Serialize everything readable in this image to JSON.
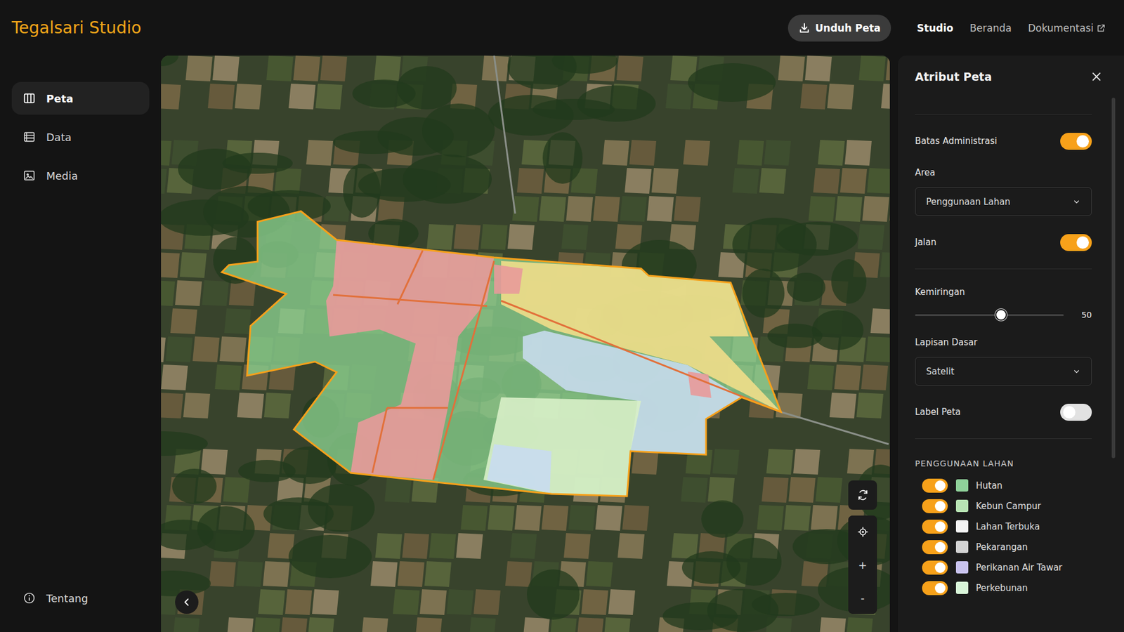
{
  "app": {
    "title": "Tegalsari Studio"
  },
  "header": {
    "download_button": {
      "label": "Unduh Peta"
    },
    "nav": [
      {
        "label": "Studio",
        "selected": true,
        "external": false
      },
      {
        "label": "Beranda",
        "selected": false,
        "external": false
      },
      {
        "label": "Dokumentasi",
        "selected": false,
        "external": true
      }
    ]
  },
  "sidebar": {
    "items": [
      {
        "label": "Peta",
        "selected": true
      },
      {
        "label": "Data",
        "selected": false
      },
      {
        "label": "Media",
        "selected": false
      }
    ],
    "footer": {
      "label": "Tentang"
    }
  },
  "map": {
    "zoom_in": "+",
    "zoom_out": "-"
  },
  "panel": {
    "title": "Atribut Peta",
    "sections": [
      [
        {
          "kind": "toggle",
          "label": "Batas Administrasi",
          "on": true
        },
        {
          "kind": "select",
          "label": "Area",
          "value": "Penggunaan Lahan"
        },
        {
          "kind": "toggle",
          "label": "Jalan",
          "on": true
        }
      ],
      [
        {
          "kind": "slider",
          "label": "Kemiringan",
          "level": 0.58,
          "reading": "50"
        },
        {
          "kind": "select",
          "label": "Lapisan Dasar",
          "value": "Satelit"
        },
        {
          "kind": "toggle",
          "label": "Label Peta",
          "on": false
        }
      ]
    ],
    "land_use": {
      "heading": "PENGGUNAAN LAHAN",
      "items": [
        {
          "label": "Hutan",
          "on": true,
          "color": "#8fd19a"
        },
        {
          "label": "Kebun Campur",
          "on": true,
          "color": "#b8e4b4"
        },
        {
          "label": "Lahan Terbuka",
          "on": true,
          "color": "#f4f4f4"
        },
        {
          "label": "Pekarangan",
          "on": true,
          "color": "#d4d4d4"
        },
        {
          "label": "Perikanan Air Tawar",
          "on": true,
          "color": "#c9c3ee"
        },
        {
          "label": "Perkebunan",
          "on": true,
          "color": "#d9f5d9"
        }
      ]
    }
  }
}
